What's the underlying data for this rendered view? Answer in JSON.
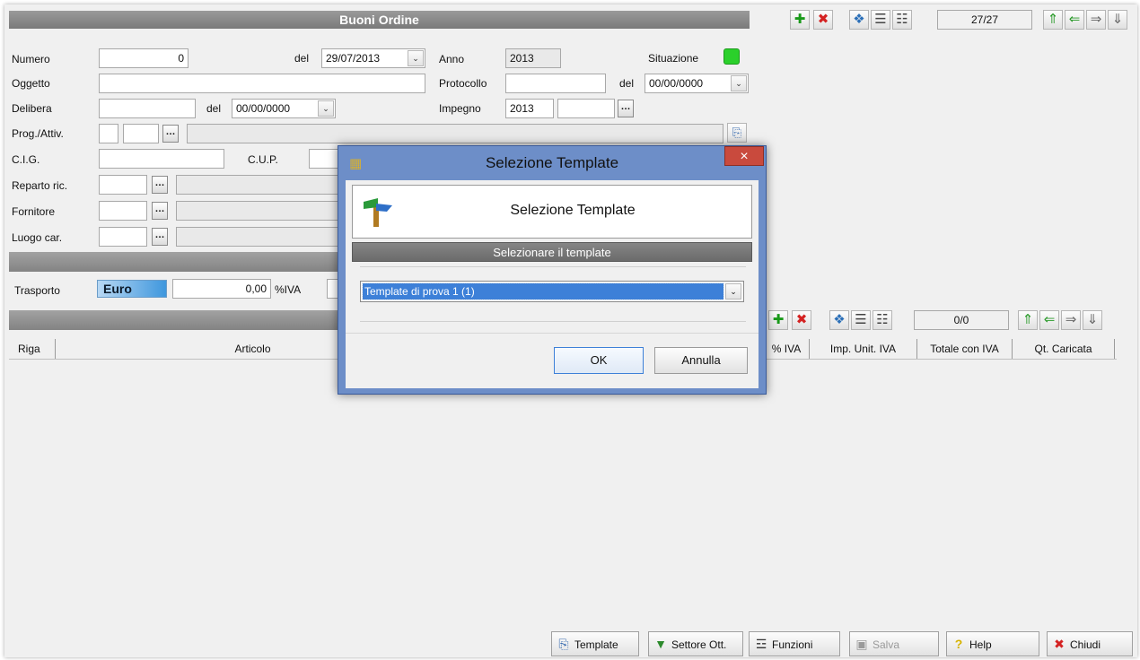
{
  "main": {
    "title": "Buoni Ordine",
    "record_counter": "27/27",
    "fields": {
      "numero_label": "Numero",
      "numero_value": "0",
      "del_label": "del",
      "numero_date": "29/07/2013",
      "anno_label": "Anno",
      "anno_value": "2013",
      "situazione_label": "Situazione",
      "situazione_color": "#2bd02b",
      "oggetto_label": "Oggetto",
      "oggetto_value": "",
      "protocollo_label": "Protocollo",
      "protocollo_value": "",
      "protocollo_del_label": "del",
      "protocollo_date": "00/00/0000",
      "delibera_label": "Delibera",
      "delibera_value": "",
      "delibera_del_label": "del",
      "delibera_date": "00/00/0000",
      "impegno_label": "Impegno",
      "impegno_value": "2013",
      "impegno_value2": "",
      "prog_label": "Prog./Attiv.",
      "cig_label": "C.I.G.",
      "cup_label": "C.U.P.",
      "reparto_label": "Reparto ric.",
      "fornitore_label": "Fornitore",
      "luogo_label": "Luogo car.",
      "trasporto_label": "Trasporto",
      "currency": "Euro",
      "trasporto_value": "0,00",
      "iva_label": "%IVA"
    }
  },
  "grid": {
    "record_counter": "0/0",
    "columns": {
      "riga": "Riga",
      "articolo": "Articolo",
      "iva": "% IVA",
      "imp_unit_iva": "Imp. Unit. IVA",
      "totale_iva": "Totale con IVA",
      "qt_caricata": "Qt. Caricata"
    }
  },
  "bottom_buttons": {
    "template": "Template",
    "settore": "Settore Ott.",
    "funzioni": "Funzioni",
    "salva": "Salva",
    "help": "Help",
    "chiudi": "Chiudi"
  },
  "dialog": {
    "title": "Selezione Template",
    "header": "Selezione Template",
    "instruction": "Selezionare il template",
    "selected_template": "Template di prova 1 (1)",
    "ok_label": "OK",
    "cancel_label": "Annulla",
    "close_glyph": "×"
  },
  "colors": {
    "accent_blue": "#6d8ec8",
    "close_red": "#c94a3d",
    "selection_blue": "#3d80d8"
  }
}
